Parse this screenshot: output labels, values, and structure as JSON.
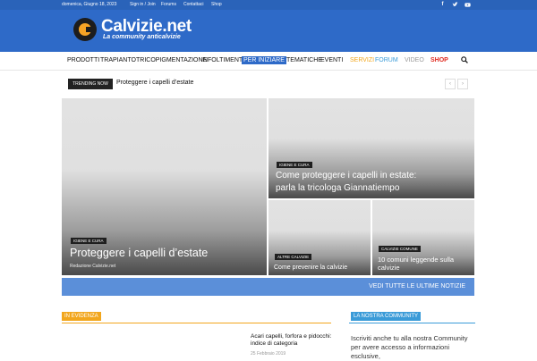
{
  "topbar": {
    "date": "domenica, Giugno 18, 2023",
    "links": [
      "Sign in / Join",
      "Forums",
      "Contattaci",
      "Shop"
    ],
    "social_icons": [
      "facebook-icon",
      "twitter-icon",
      "youtube-icon"
    ]
  },
  "header": {
    "logo_text": "Calvizie.net",
    "tagline": "La community anticalvizie"
  },
  "nav": {
    "items": [
      {
        "label": "PRODOTTI",
        "color": "#111111"
      },
      {
        "label": "TRAPIANTO",
        "color": "#111111"
      },
      {
        "label": "TRICOPIGMENTAZIONE",
        "color": "#111111"
      },
      {
        "label": "INFOLTIMENTI",
        "color": "#111111"
      },
      {
        "label": "PER INIZIARE",
        "color": "#ffffff",
        "active": true
      },
      {
        "label": "TEMATICHE",
        "color": "#111111"
      },
      {
        "label": "EVENTI",
        "color": "#111111"
      },
      {
        "label": "SERVIZI",
        "color": "#f2a61c"
      },
      {
        "label": "FORUM",
        "color": "#3a9bd8"
      },
      {
        "label": "VIDEO",
        "color": "#999999"
      },
      {
        "label": "SHOP",
        "color": "#e0291e"
      }
    ],
    "search_icon": "search-icon"
  },
  "trending": {
    "label": "TRENDING NOW",
    "text": "Proteggere i capelli d’estate",
    "prev_icon": "chevron-left-icon",
    "next_icon": "chevron-right-icon"
  },
  "featured": {
    "main": {
      "category": "IGIENE E CURA",
      "title": "Proteggere i capelli d’estate",
      "author": "Redazione Calvizie.net"
    },
    "top_right": {
      "category": "IGIENE E CURA",
      "title_line1": "Come proteggere i capelli in estate:",
      "title_line2": "parla la tricologa Giannatiempo"
    },
    "bottom_left": {
      "category": "ALTRE CALVIZIE",
      "title": "Come prevenire la calvizie"
    },
    "bottom_right": {
      "category": "CALVIZIE COMUNE",
      "title_line1": "10 comuni leggende sulla",
      "title_line2": "calvizie"
    }
  },
  "view_all": "VEDI TUTTE LE ULTIME NOTIZIE",
  "sections": {
    "evidenza": {
      "label": "IN EVIDENZA",
      "color": "#f2a61c"
    },
    "community": {
      "label": "LA NOSTRA COMMUNITY",
      "color": "#3a9bd8"
    }
  },
  "article": {
    "title": "Acari capelli, forfora e pidocchi: indice di categoria",
    "date": "25 Febbraio 2019"
  },
  "community_text": "Iscriviti anche tu alla nostra Community per avere accesso a informazioni esclusive,"
}
